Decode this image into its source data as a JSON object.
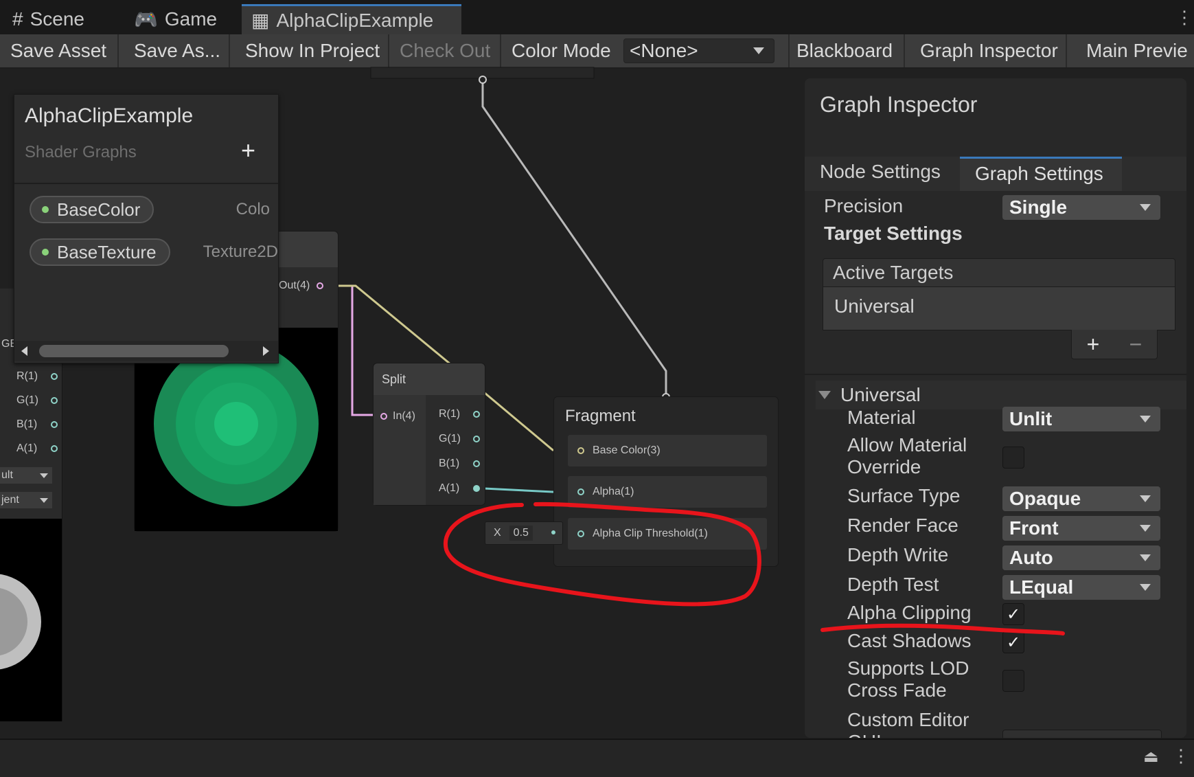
{
  "tabs": [
    {
      "label": "Scene",
      "icon": "grid-icon"
    },
    {
      "label": "Game",
      "icon": "gamepad-icon"
    },
    {
      "label": "AlphaClipExample",
      "icon": "shadergraph-icon"
    }
  ],
  "toolbar": {
    "save_asset": "Save Asset",
    "save_as": "Save As...",
    "show_in_project": "Show In Project",
    "check_out": "Check Out",
    "color_mode_label": "Color Mode",
    "color_mode_value": "<None>",
    "blackboard": "Blackboard",
    "graph_inspector": "Graph Inspector",
    "main_preview": "Main Previe"
  },
  "blackboard": {
    "title": "AlphaClipExample",
    "subtitle": "Shader Graphs",
    "add_symbol": "+",
    "properties": [
      {
        "name": "BaseColor",
        "type": "Colo"
      },
      {
        "name": "BaseTexture",
        "type": "Texture2D"
      }
    ]
  },
  "left_node": {
    "ports": [
      "R(1)",
      "G(1)",
      "B(1)",
      "A(1)"
    ],
    "dropdown1": "ult",
    "dropdown2": "jent",
    "cut_label": "GE"
  },
  "texture_node": {
    "out_label": "Out(4)"
  },
  "split_node": {
    "title": "Split",
    "input": "In(4)",
    "outputs": [
      "R(1)",
      "G(1)",
      "B(1)",
      "A(1)"
    ]
  },
  "fragment_node": {
    "title": "Fragment",
    "slots": [
      "Base Color(3)",
      "Alpha(1)",
      "Alpha Clip Threshold(1)"
    ],
    "threshold_axis": "X",
    "threshold_value": "0.5"
  },
  "inspector": {
    "title": "Graph Inspector",
    "tabs": [
      "Node Settings",
      "Graph Settings"
    ],
    "active_tab": "Graph Settings",
    "precision_label": "Precision",
    "precision_value": "Single",
    "target_settings": "Target Settings",
    "active_targets_label": "Active Targets",
    "active_target": "Universal",
    "add_symbol": "+",
    "remove_symbol": "−",
    "section": "Universal",
    "rows": [
      {
        "label": "Material",
        "value": "Unlit",
        "kind": "dropdown"
      },
      {
        "label": "Allow Material Override",
        "checked": false,
        "kind": "checkbox"
      },
      {
        "label": "Surface Type",
        "value": "Opaque",
        "kind": "dropdown"
      },
      {
        "label": "Render Face",
        "value": "Front",
        "kind": "dropdown"
      },
      {
        "label": "Depth Write",
        "value": "Auto",
        "kind": "dropdown"
      },
      {
        "label": "Depth Test",
        "value": "LEqual",
        "kind": "dropdown"
      },
      {
        "label": "Alpha Clipping",
        "checked": true,
        "kind": "checkbox"
      },
      {
        "label": "Cast Shadows",
        "checked": true,
        "kind": "checkbox"
      },
      {
        "label": "Supports LOD Cross Fade",
        "checked": false,
        "kind": "checkbox"
      },
      {
        "label": "Custom Editor GUI",
        "value": "",
        "kind": "text"
      }
    ]
  },
  "colors": {
    "accent": "#3a79bb",
    "annotation": "#e8141b",
    "preview_green": "#1fae6a"
  }
}
